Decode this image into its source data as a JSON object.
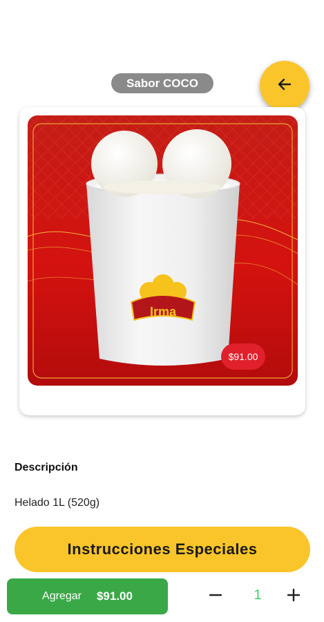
{
  "header": {
    "title": "Sabor COCO"
  },
  "product": {
    "price_badge": "$91.00",
    "logo_text": "Irma"
  },
  "description": {
    "heading": "Descripción",
    "text": "Helado 1L (520g)"
  },
  "actions": {
    "special_instructions_label": "Instrucciones Especiales",
    "add_label": "Agregar",
    "add_price": "$91.00",
    "quantity": "1"
  },
  "icons": {
    "back": "arrow-left-icon",
    "minus": "minus-icon",
    "plus": "plus-icon"
  },
  "colors": {
    "accent_yellow": "#f9c52a",
    "add_green": "#3aa847",
    "qty_green": "#3bd16b",
    "price_red": "#e0202b",
    "pill_gray": "#8a8a8a"
  }
}
